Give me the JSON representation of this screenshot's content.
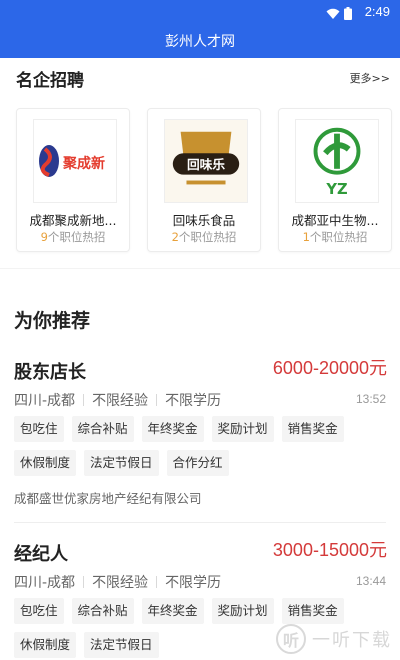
{
  "status_bar": {
    "time": "2:49"
  },
  "app_bar": {
    "title": "彭州人才网"
  },
  "famous": {
    "title": "名企招聘",
    "more": "更多>>",
    "companies": [
      {
        "name": "成都聚成新地...",
        "job_count": "9",
        "jobs_suffix": "个职位热招",
        "logo_text": "聚成新"
      },
      {
        "name": "回味乐食品",
        "job_count": "2",
        "jobs_suffix": "个职位热招",
        "logo_text": "回味乐"
      },
      {
        "name": "成都亚中生物...",
        "job_count": "1",
        "jobs_suffix": "个职位热招",
        "logo_text": "YZ"
      }
    ]
  },
  "recommend": {
    "title": "为你推荐",
    "jobs": [
      {
        "title": "股东店长",
        "salary": "6000-20000元",
        "location": "四川-成都",
        "experience": "不限经验",
        "education": "不限学历",
        "time": "13:52",
        "tags": [
          "包吃住",
          "综合补贴",
          "年终奖金",
          "奖励计划",
          "销售奖金",
          "休假制度",
          "法定节假日",
          "合作分红"
        ],
        "company": "成都盛世优家房地产经纪有限公司"
      },
      {
        "title": "经纪人",
        "salary": "3000-15000元",
        "location": "四川-成都",
        "experience": "不限经验",
        "education": "不限学历",
        "time": "13:44",
        "tags": [
          "包吃住",
          "综合补贴",
          "年终奖金",
          "奖励计划",
          "销售奖金",
          "休假制度",
          "法定节假日"
        ],
        "company": ""
      }
    ]
  },
  "watermark": {
    "text": "一听下载",
    "icon_char": "听"
  }
}
